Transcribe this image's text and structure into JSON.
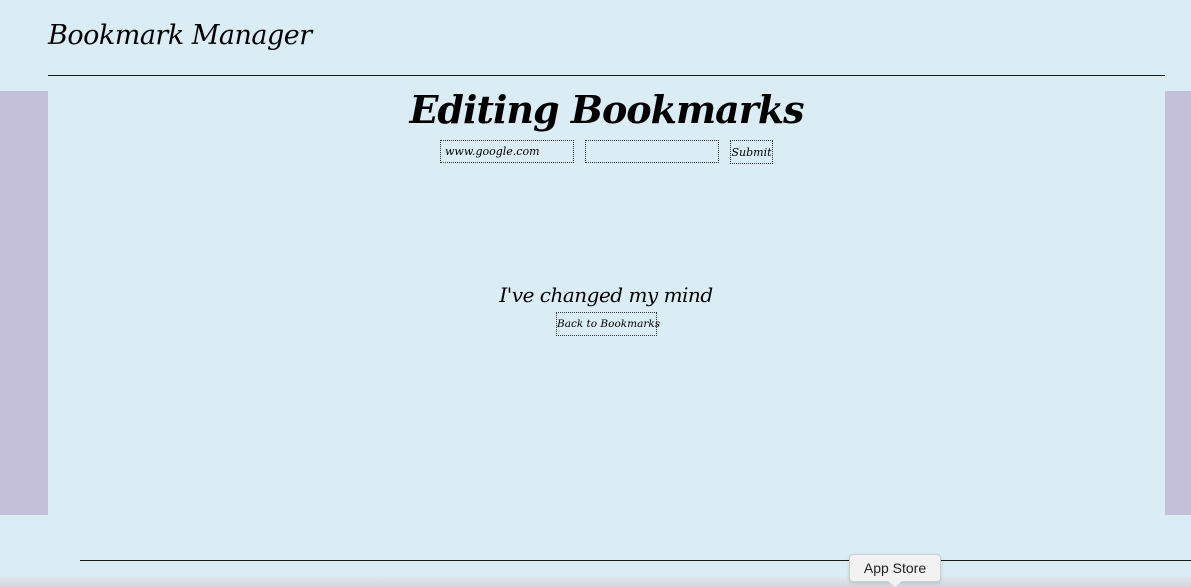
{
  "header": {
    "title": "Bookmark Manager"
  },
  "main": {
    "heading": "Editing Bookmarks",
    "form": {
      "url_value": "www.google.com",
      "name_value": "",
      "submit_label": "Submit"
    },
    "cancel": {
      "prompt": "I've changed my mind",
      "back_label": "Back to Bookmarks"
    }
  },
  "dock": {
    "tooltip": "App Store"
  },
  "colors": {
    "background": "#dbedf4",
    "side_panel": "#c4c0d9",
    "rule": "#1a1a1a"
  }
}
